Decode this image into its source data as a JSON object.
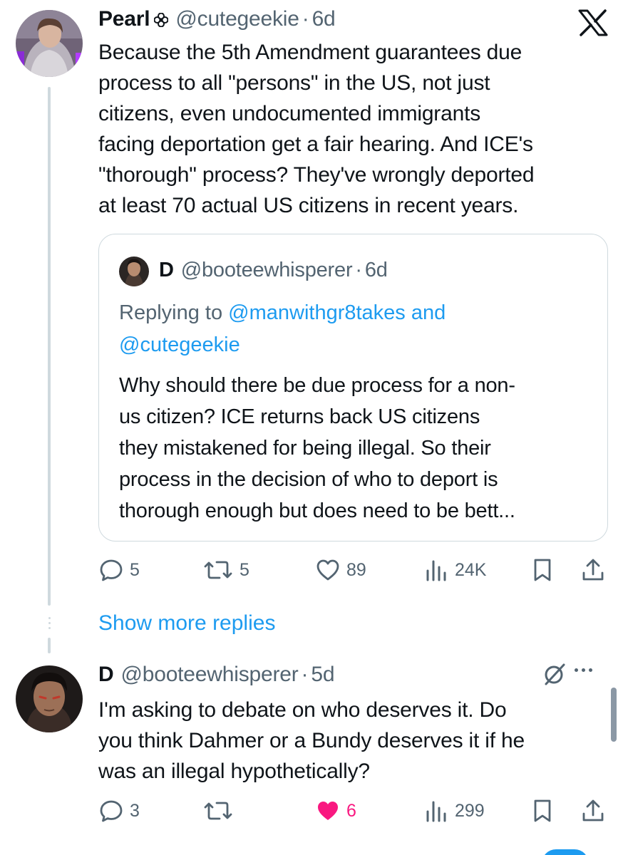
{
  "app": {
    "logo_icon": "x-logo-icon"
  },
  "tweet": {
    "author_name": "Pearl",
    "author_badge_icon": "flower-icon",
    "handle": "@cutegeekie",
    "separator": "·",
    "time": "6d",
    "lines": [
      "Because the 5th Amendment guarantees due",
      "process to all \"persons\" in the US, not just",
      "citizens, even undocumented immigrants",
      "facing deportation get a fair hearing. And ICE's",
      "\"thorough\" process? They've wrongly deported",
      "at least 70 actual US citizens in recent years."
    ],
    "quote": {
      "author_name": "D",
      "handle": "@booteewhisperer",
      "separator": "·",
      "time": "6d",
      "replying_prefix": "Replying to ",
      "replying_user1": "@manwithgr8takes",
      "replying_and": " and",
      "replying_user2": "@cutegeekie",
      "lines": [
        "Why should there be due process for a non-",
        "us citizen? ICE returns back US citizens",
        "they mistakened for being illegal. So their",
        "process in the decision of who to deport is",
        "thorough enough but does need to be bett..."
      ]
    },
    "actions": {
      "replies": "5",
      "reposts": "5",
      "likes": "89",
      "views": "24K"
    }
  },
  "show_more_replies": "Show more replies",
  "reply": {
    "author_name": "D",
    "handle": "@booteewhisperer",
    "separator": "·",
    "time": "5d",
    "lines": [
      "I'm asking to debate on who deserves it. Do",
      "you think Dahmer or a Bundy deserves it if he",
      "was an illegal hypothetically?"
    ],
    "actions": {
      "replies": "3",
      "reposts": "",
      "likes": "6",
      "likes_liked": true,
      "views": "299"
    }
  },
  "colors": {
    "accent": "#1d9bf0",
    "like": "#f91880",
    "text": "#0f1419",
    "muted": "#536471",
    "border": "#cfd9de"
  }
}
